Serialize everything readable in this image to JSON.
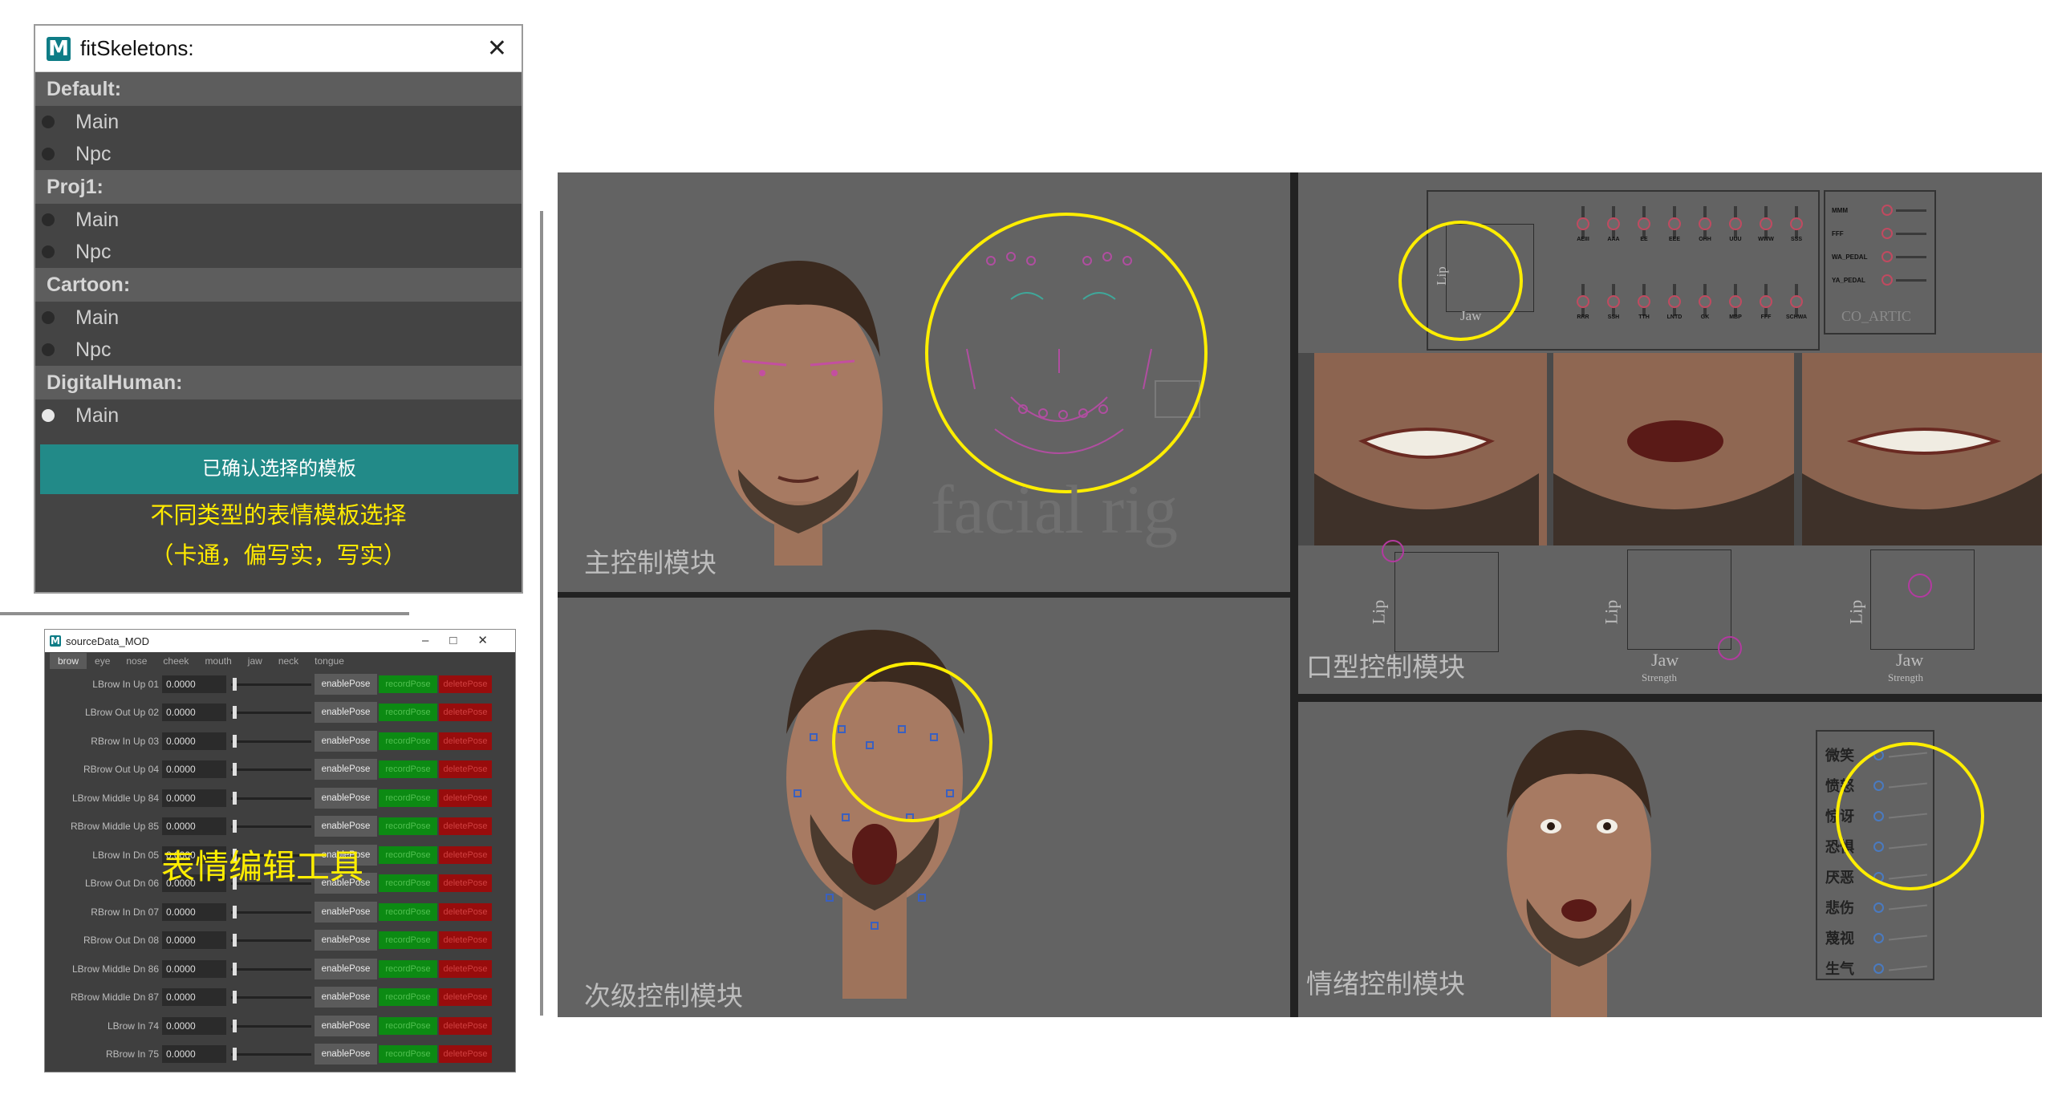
{
  "fit_window": {
    "title": "fitSkeletons:",
    "groups": [
      {
        "label": "Default:",
        "options": [
          {
            "label": "Main",
            "selected": false
          },
          {
            "label": "Npc",
            "selected": false
          }
        ]
      },
      {
        "label": "Proj1:",
        "options": [
          {
            "label": "Main",
            "selected": false
          },
          {
            "label": "Npc",
            "selected": false
          }
        ]
      },
      {
        "label": "Cartoon:",
        "options": [
          {
            "label": "Main",
            "selected": false
          },
          {
            "label": "Npc",
            "selected": false
          }
        ]
      },
      {
        "label": "DigitalHuman:",
        "options": [
          {
            "label": "Main",
            "selected": true
          }
        ]
      }
    ],
    "confirm_label": "已确认选择的模板",
    "note_line1": "不同类型的表情模板选择",
    "note_line2": "（卡通，偏写实，写实）"
  },
  "src_window": {
    "title": "sourceData_MOD",
    "tabs": [
      "brow",
      "eye",
      "nose",
      "cheek",
      "mouth",
      "jaw",
      "neck",
      "tongue"
    ],
    "active_tab": "brow",
    "enable_label": "enablePose",
    "record_label": "recordPose",
    "delete_label": "deletePose",
    "rows": [
      {
        "label": "LBrow In Up 01",
        "value": "0.0000"
      },
      {
        "label": "LBrow Out Up 02",
        "value": "0.0000"
      },
      {
        "label": "RBrow In Up 03",
        "value": "0.0000"
      },
      {
        "label": "RBrow Out Up 04",
        "value": "0.0000"
      },
      {
        "label": "LBrow Middle Up 84",
        "value": "0.0000"
      },
      {
        "label": "RBrow Middle Up 85",
        "value": "0.0000"
      },
      {
        "label": "LBrow In Dn 05",
        "value": "0.0000"
      },
      {
        "label": "LBrow Out Dn 06",
        "value": "0.0000"
      },
      {
        "label": "RBrow In Dn 07",
        "value": "0.0000"
      },
      {
        "label": "RBrow Out Dn 08",
        "value": "0.0000"
      },
      {
        "label": "LBrow Middle Dn 86",
        "value": "0.0000"
      },
      {
        "label": "RBrow Middle Dn 87",
        "value": "0.0000"
      },
      {
        "label": "LBrow In 74",
        "value": "0.0000"
      },
      {
        "label": "RBrow In 75",
        "value": "0.0000"
      }
    ],
    "overlay": "表情编辑工具"
  },
  "collage": {
    "main_label": "主控制模块",
    "secondary_label": "次级控制模块",
    "mouth_label": "口型控制模块",
    "emotion_label": "情绪控制模块",
    "watermark": "facial rig",
    "lip": "Lip",
    "jaw": "Jaw",
    "strength": "Strength",
    "co_artic": "CO_ARTIC",
    "viseme_top": [
      "AEIII",
      "AAA",
      "EE",
      "EEE",
      "OHH",
      "UUU",
      "WWW",
      "SSS"
    ],
    "viseme_bottom": [
      "RRR",
      "SSH",
      "TTH",
      "LNTD",
      "GK",
      "MBP",
      "FFF",
      "SCHWA"
    ],
    "side_controls": [
      "MMM",
      "FFF",
      "WA_PEDAL",
      "YA_PEDAL"
    ],
    "emotions": [
      "微笑",
      "愤怒",
      "惊讶",
      "恐惧",
      "厌恶",
      "悲伤",
      "蔑视",
      "生气"
    ]
  },
  "colors": {
    "teal": "#228a88",
    "highlight": "#ffee00",
    "panel": "#636363",
    "record": "#0c8a13",
    "delete": "#980c0c"
  }
}
